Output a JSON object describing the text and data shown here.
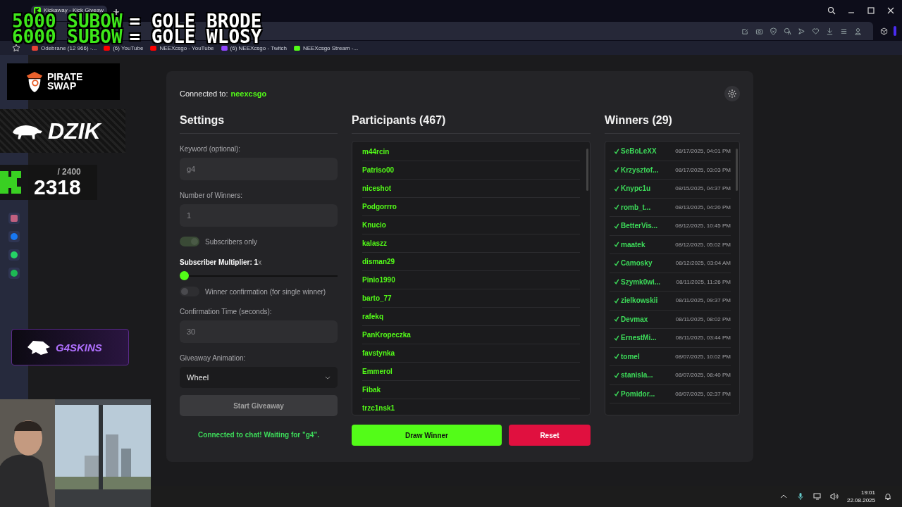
{
  "browser": {
    "tab": {
      "title": "Kickaway - Kick Giveaw"
    },
    "bookmarks": [
      {
        "kind": "mail",
        "label": "Odebrane (12 966) -..."
      },
      {
        "kind": "youtube",
        "label": "(6) YouTube"
      },
      {
        "kind": "youtube",
        "label": "NEEXcsgo - YouTube"
      },
      {
        "kind": "twitch",
        "label": "(6) NEEXcsgo - Twitch"
      },
      {
        "kind": "kick",
        "label": "NEEXcsgo Stream -..."
      }
    ]
  },
  "page": {
    "connected_label": "Connected to:",
    "channel": "neexcsgo",
    "settings": {
      "title": "Settings",
      "keyword": {
        "label": "Keyword (optional):",
        "value": "g4"
      },
      "winners_count": {
        "label": "Number of Winners:",
        "value": "1"
      },
      "subscribers_only": {
        "label": "Subscribers only",
        "on": true
      },
      "multiplier": {
        "label": "**Subscriber Multiplier: 1**x",
        "level": 0
      },
      "winner_confirmation": {
        "label": "Winner confirmation (for single winner)",
        "on": false
      },
      "confirmation_time": {
        "label": "Confirmation Time (seconds):",
        "value": "30"
      },
      "animation": {
        "label": "Giveaway Animation:",
        "value": "Wheel"
      },
      "start_button": "Start Giveaway",
      "status": "Connected to chat! Waiting for \"g4\"."
    },
    "participants": {
      "title": "Participants (467)",
      "names": [
        "m44rcin",
        "Patriso00",
        "niceshot",
        "Podgorrro",
        "Knucio",
        "kalaszz",
        "disman29",
        "Pinio1990",
        "barto_77",
        "rafekq",
        "PanKropeczka",
        "favstynka",
        "Emmerol",
        "Fibak",
        "trzc1nsk1"
      ],
      "draw_button": "Draw Winner",
      "reset_button": "Reset"
    },
    "winners": {
      "title": "Winners (29)",
      "rows": [
        {
          "name": "SeBoLeXX",
          "date": "08/17/2025, 04:01 PM"
        },
        {
          "name": "Krzysztof...",
          "date": "08/17/2025, 03:03 PM"
        },
        {
          "name": "Knypc1u",
          "date": "08/15/2025, 04:37 PM"
        },
        {
          "name": "romb_t...",
          "date": "08/13/2025, 04:20 PM"
        },
        {
          "name": "BetterVis...",
          "date": "08/12/2025, 10:45 PM"
        },
        {
          "name": "maatek",
          "date": "08/12/2025, 05:02 PM"
        },
        {
          "name": "Camosky",
          "date": "08/12/2025, 03:04 AM"
        },
        {
          "name": "Szymk0wi...",
          "date": "08/11/2025, 11:26 PM"
        },
        {
          "name": "zielkowskii",
          "date": "08/11/2025, 09:37 PM"
        },
        {
          "name": "Devmax",
          "date": "08/11/2025, 08:02 PM"
        },
        {
          "name": "ErnestMi...",
          "date": "08/11/2025, 03:44 PM"
        },
        {
          "name": "tomel",
          "date": "08/07/2025, 10:02 PM"
        },
        {
          "name": "stanisla...",
          "date": "08/07/2025, 08:40 PM"
        },
        {
          "name": "Pomidor...",
          "date": "08/07/2025, 02:37 PM"
        }
      ]
    }
  },
  "stream_overlay": {
    "goals": [
      {
        "count": "5000 SUBOW",
        "reward": "= GOLE BRODE"
      },
      {
        "count": "6000 SUBOW",
        "reward": "= GOLE WLOSY"
      }
    ],
    "sponsors": [
      {
        "kind": "pirateswap",
        "lines": [
          "PIRATE",
          "SWAP"
        ]
      },
      {
        "kind": "dzik",
        "lines": [
          "DZIK"
        ]
      },
      {
        "kind": "g4skins",
        "lines": [
          "G4SKINS"
        ]
      }
    ],
    "counter": {
      "target": "/ 2400",
      "current": "2318"
    }
  },
  "taskbar": {
    "time": "19:01",
    "date": "22.08.2025"
  }
}
